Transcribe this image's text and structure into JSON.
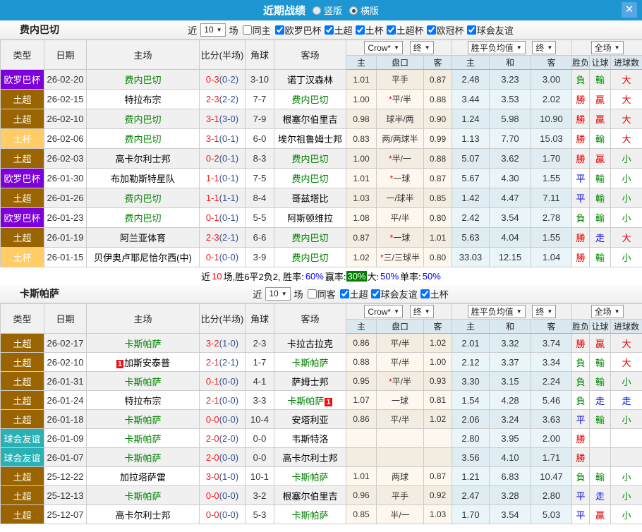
{
  "topbar": {
    "title": "近期战绩",
    "vertical_label": "竖版",
    "horizontal_label": "横版",
    "close_glyph": "✕"
  },
  "table_header": {
    "type": "类型",
    "date": "日期",
    "home": "主场",
    "score": "比分(半场)",
    "corner": "角球",
    "away": "客场",
    "sub": [
      "主",
      "盘口",
      "客",
      "主",
      "和",
      "客",
      "胜负",
      "让球",
      "进球数"
    ],
    "selects": {
      "company": "Crow*",
      "final": "终",
      "avg": "胜平负均值",
      "scope": "全场"
    },
    "arrow": "▼"
  },
  "colors": {
    "europa": "#7d00da",
    "super_lig": "#9a6500",
    "cup": "#ffcc66",
    "friendly": "#29b1b6",
    "team_green": "#008000",
    "win": "#e60000",
    "lose": "#008800",
    "draw": "#0000e0"
  },
  "sections": [
    {
      "team": "费内巴切",
      "filter": {
        "near_label": "近",
        "count": "10",
        "unit_label": "场",
        "same_label": "同主",
        "leagues": [
          "欧罗巴杯",
          "土超",
          "土杯",
          "土超杯",
          "欧冠杯",
          "球会友谊"
        ]
      },
      "rows": [
        {
          "type": "欧罗巴杯",
          "type_color": "#7d00da",
          "date": "26-02-20",
          "home": "费内巴切",
          "home_color": "#008000",
          "score": "0-3",
          "half": "(0-2)",
          "corner": "3-10",
          "away": "诺丁汉森林",
          "w1": "1.01",
          "handicap": "平手",
          "w2": "0.87",
          "avg_h": "2.48",
          "avg_d": "3.23",
          "avg_a": "3.00",
          "wdl": "負",
          "wdl_color": "#008800",
          "asian": "輸",
          "asian_color": "#008800",
          "ou": "大",
          "ou_color": "#e60000"
        },
        {
          "type": "土超",
          "type_color": "#9a6500",
          "date": "26-02-15",
          "home": "特拉布宗",
          "score": "2-3",
          "half": "(2-2)",
          "corner": "7-7",
          "away": "费内巴切",
          "away_color": "#008000",
          "w1": "1.00",
          "hstar": "*",
          "handicap": "平/半",
          "w2": "0.88",
          "avg_h": "3.44",
          "avg_d": "3.53",
          "avg_a": "2.02",
          "wdl": "勝",
          "wdl_color": "#e60000",
          "asian": "贏",
          "asian_color": "#e60000",
          "ou": "大",
          "ou_color": "#e60000"
        },
        {
          "type": "土超",
          "type_color": "#9a6500",
          "date": "26-02-10",
          "home": "费内巴切",
          "home_color": "#008000",
          "score": "3-1",
          "half": "(3-0)",
          "corner": "7-9",
          "away": "根塞尔伯里吉",
          "w1": "0.98",
          "handicap": "球半/两",
          "w2": "0.90",
          "avg_h": "1.24",
          "avg_d": "5.98",
          "avg_a": "10.90",
          "wdl": "勝",
          "wdl_color": "#e60000",
          "asian": "贏",
          "asian_color": "#e60000",
          "ou": "大",
          "ou_color": "#e60000"
        },
        {
          "type": "土杯",
          "type_color": "#ffcc66",
          "date": "26-02-06",
          "home": "费内巴切",
          "home_color": "#008000",
          "score": "3-1",
          "half": "(0-1)",
          "corner": "6-0",
          "away": "埃尔祖鲁姆士邦",
          "w1": "0.83",
          "handicap": "两/两球半",
          "w2": "0.99",
          "avg_h": "1.13",
          "avg_d": "7.70",
          "avg_a": "15.03",
          "wdl": "勝",
          "wdl_color": "#e60000",
          "asian": "輸",
          "asian_color": "#008800",
          "ou": "大",
          "ou_color": "#e60000"
        },
        {
          "type": "土超",
          "type_color": "#9a6500",
          "date": "26-02-03",
          "home": "高卡尔利士邦",
          "score": "0-2",
          "half": "(0-1)",
          "corner": "8-3",
          "away": "费内巴切",
          "away_color": "#008000",
          "w1": "1.00",
          "hstar": "*",
          "handicap": "半/一",
          "w2": "0.88",
          "avg_h": "5.07",
          "avg_d": "3.62",
          "avg_a": "1.70",
          "wdl": "勝",
          "wdl_color": "#e60000",
          "asian": "贏",
          "asian_color": "#e60000",
          "ou": "小",
          "ou_color": "#008800"
        },
        {
          "type": "欧罗巴杯",
          "type_color": "#7d00da",
          "date": "26-01-30",
          "home": "布加勒斯特星队",
          "score": "1-1",
          "half": "(0-1)",
          "corner": "7-5",
          "away": "费内巴切",
          "away_color": "#008000",
          "w1": "1.01",
          "hstar": "*",
          "handicap": "一球",
          "w2": "0.87",
          "avg_h": "5.67",
          "avg_d": "4.30",
          "avg_a": "1.55",
          "wdl": "平",
          "wdl_color": "#0000e0",
          "asian": "輸",
          "asian_color": "#008800",
          "ou": "小",
          "ou_color": "#008800"
        },
        {
          "type": "土超",
          "type_color": "#9a6500",
          "date": "26-01-26",
          "home": "费内巴切",
          "home_color": "#008000",
          "score": "1-1",
          "half": "(1-1)",
          "corner": "8-4",
          "away": "哥兹塔比",
          "w1": "1.03",
          "handicap": "一/球半",
          "w2": "0.85",
          "avg_h": "1.42",
          "avg_d": "4.47",
          "avg_a": "7.11",
          "wdl": "平",
          "wdl_color": "#0000e0",
          "asian": "輸",
          "asian_color": "#008800",
          "ou": "小",
          "ou_color": "#008800"
        },
        {
          "type": "欧罗巴杯",
          "type_color": "#7d00da",
          "date": "26-01-23",
          "home": "费内巴切",
          "home_color": "#008000",
          "score": "0-1",
          "half": "(0-1)",
          "corner": "5-5",
          "away": "阿斯顿维拉",
          "w1": "1.08",
          "handicap": "平/半",
          "w2": "0.80",
          "avg_h": "2.42",
          "avg_d": "3.54",
          "avg_a": "2.78",
          "wdl": "負",
          "wdl_color": "#008800",
          "asian": "輸",
          "asian_color": "#008800",
          "ou": "小",
          "ou_color": "#008800"
        },
        {
          "type": "土超",
          "type_color": "#9a6500",
          "date": "26-01-19",
          "home": "阿兰亚体育",
          "score": "2-3",
          "half": "(2-1)",
          "corner": "6-6",
          "away": "费内巴切",
          "away_color": "#008000",
          "w1": "0.87",
          "hstar": "*",
          "handicap": "一球",
          "w2": "1.01",
          "avg_h": "5.63",
          "avg_d": "4.04",
          "avg_a": "1.55",
          "wdl": "勝",
          "wdl_color": "#e60000",
          "asian": "走",
          "asian_color": "#0000e0",
          "ou": "大",
          "ou_color": "#e60000"
        },
        {
          "type": "土杯",
          "type_color": "#ffcc66",
          "date": "26-01-15",
          "home": "贝伊奥卢耶尼恰尔西(中)",
          "score": "0-1",
          "half": "(0-0)",
          "corner": "3-9",
          "away": "费内巴切",
          "away_color": "#008000",
          "w1": "1.02",
          "hstar": "*",
          "handicap": "三/三球半",
          "w2": "0.80",
          "avg_h": "33.03",
          "avg_d": "12.15",
          "avg_a": "1.04",
          "wdl": "勝",
          "wdl_color": "#e60000",
          "asian": "輸",
          "asian_color": "#008800",
          "ou": "小",
          "ou_color": "#008800"
        }
      ],
      "summary": [
        {
          "text": "近",
          "color": "#000000"
        },
        {
          "text": "10",
          "color": "#ff0000"
        },
        {
          "text": "场,胜6平2负2, 胜率:",
          "color": "#000000"
        },
        {
          "text": "60%",
          "color": "#0000ff"
        },
        {
          "text": " 赢率: ",
          "color": "#000000"
        },
        {
          "text": "30%",
          "color": "#ffffff",
          "bg": "#008000"
        },
        {
          "text": " 大:",
          "color": "#000000"
        },
        {
          "text": "50%",
          "color": "#0000ff"
        },
        {
          "text": " 单率:",
          "color": "#000000"
        },
        {
          "text": "50%",
          "color": "#0000ff"
        }
      ]
    },
    {
      "team": "卡斯帕萨",
      "filter": {
        "near_label": "近",
        "count": "10",
        "unit_label": "场",
        "same_label": "同客",
        "leagues": [
          "土超",
          "球会友谊",
          "土杯"
        ]
      },
      "rows": [
        {
          "type": "土超",
          "type_color": "#9a6500",
          "date": "26-02-17",
          "home": "卡斯帕萨",
          "home_color": "#008000",
          "score": "3-2",
          "half": "(1-0)",
          "corner": "2-3",
          "away": "卡拉古拉克",
          "w1": "0.86",
          "handicap": "平/半",
          "w2": "1.02",
          "avg_h": "2.01",
          "avg_d": "3.32",
          "avg_a": "3.74",
          "wdl": "勝",
          "wdl_color": "#e60000",
          "asian": "贏",
          "asian_color": "#e60000",
          "ou": "大",
          "ou_color": "#e60000"
        },
        {
          "type": "土超",
          "type_color": "#9a6500",
          "date": "26-02-10",
          "home_card_pre": "1",
          "home": "加斯安泰普",
          "score": "2-1",
          "half": "(2-1)",
          "corner": "1-7",
          "away": "卡斯帕萨",
          "away_color": "#008000",
          "w1": "0.88",
          "handicap": "平/半",
          "w2": "1.00",
          "avg_h": "2.12",
          "avg_d": "3.37",
          "avg_a": "3.34",
          "wdl": "負",
          "wdl_color": "#008800",
          "asian": "輸",
          "asian_color": "#008800",
          "ou": "大",
          "ou_color": "#e60000"
        },
        {
          "type": "土超",
          "type_color": "#9a6500",
          "date": "26-01-31",
          "home": "卡斯帕萨",
          "home_color": "#008000",
          "score": "0-1",
          "half": "(0-0)",
          "corner": "4-1",
          "away": "萨姆士邦",
          "w1": "0.95",
          "hstar": "*",
          "handicap": "平/半",
          "w2": "0.93",
          "avg_h": "3.30",
          "avg_d": "3.15",
          "avg_a": "2.24",
          "wdl": "負",
          "wdl_color": "#008800",
          "asian": "輸",
          "asian_color": "#008800",
          "ou": "小",
          "ou_color": "#008800"
        },
        {
          "type": "土超",
          "type_color": "#9a6500",
          "date": "26-01-24",
          "home": "特拉布宗",
          "score": "2-1",
          "half": "(0-0)",
          "corner": "3-3",
          "away": "卡斯帕萨",
          "away_color": "#008000",
          "away_card_post": "1",
          "w1": "1.07",
          "handicap": "一球",
          "w2": "0.81",
          "avg_h": "1.54",
          "avg_d": "4.28",
          "avg_a": "5.46",
          "wdl": "負",
          "wdl_color": "#008800",
          "asian": "走",
          "asian_color": "#0000e0",
          "ou": "走",
          "ou_color": "#0000e0"
        },
        {
          "type": "土超",
          "type_color": "#9a6500",
          "date": "26-01-18",
          "home": "卡斯帕萨",
          "home_color": "#008000",
          "score": "0-0",
          "half": "(0-0)",
          "corner": "10-4",
          "away": "安塔利亚",
          "w1": "0.86",
          "handicap": "平/半",
          "w2": "1.02",
          "avg_h": "2.06",
          "avg_d": "3.24",
          "avg_a": "3.63",
          "wdl": "平",
          "wdl_color": "#0000e0",
          "asian": "輸",
          "asian_color": "#008800",
          "ou": "小",
          "ou_color": "#008800"
        },
        {
          "type": "球会友谊",
          "type_color": "#29b1b6",
          "date": "26-01-09",
          "home": "卡斯帕萨",
          "home_color": "#008000",
          "score": "2-0",
          "half": "(2-0)",
          "corner": "0-0",
          "away": "韦斯特洛",
          "avg_h": "2.80",
          "avg_d": "3.95",
          "avg_a": "2.00",
          "wdl": "勝",
          "wdl_color": "#e60000"
        },
        {
          "type": "球会友谊",
          "type_color": "#29b1b6",
          "date": "26-01-07",
          "home": "卡斯帕萨",
          "home_color": "#008000",
          "score": "2-0",
          "half": "(0-0)",
          "corner": "0-0",
          "away": "高卡尔利士邦",
          "avg_h": "3.56",
          "avg_d": "4.10",
          "avg_a": "1.71",
          "wdl": "勝",
          "wdl_color": "#e60000"
        },
        {
          "type": "土超",
          "type_color": "#9a6500",
          "date": "25-12-22",
          "home": "加拉塔萨雷",
          "score": "3-0",
          "half": "(1-0)",
          "corner": "10-1",
          "away": "卡斯帕萨",
          "away_color": "#008000",
          "w1": "1.01",
          "handicap": "两球",
          "w2": "0.87",
          "avg_h": "1.21",
          "avg_d": "6.83",
          "avg_a": "10.47",
          "wdl": "負",
          "wdl_color": "#008800",
          "asian": "輸",
          "asian_color": "#008800",
          "ou": "小",
          "ou_color": "#008800"
        },
        {
          "type": "土超",
          "type_color": "#9a6500",
          "date": "25-12-13",
          "home": "卡斯帕萨",
          "home_color": "#008000",
          "score": "0-0",
          "half": "(0-0)",
          "corner": "3-2",
          "away": "根塞尔伯里吉",
          "w1": "0.96",
          "handicap": "平手",
          "w2": "0.92",
          "avg_h": "2.47",
          "avg_d": "3.28",
          "avg_a": "2.80",
          "wdl": "平",
          "wdl_color": "#0000e0",
          "asian": "走",
          "asian_color": "#0000e0",
          "ou": "小",
          "ou_color": "#008800"
        },
        {
          "type": "土超",
          "type_color": "#9a6500",
          "date": "25-12-07",
          "home": "高卡尔利士邦",
          "score": "0-0",
          "half": "(0-0)",
          "corner": "5-3",
          "away": "卡斯帕萨",
          "away_color": "#008000",
          "w1": "0.85",
          "handicap": "半/一",
          "w2": "1.03",
          "avg_h": "1.70",
          "avg_d": "3.54",
          "avg_a": "5.03",
          "wdl": "平",
          "wdl_color": "#0000e0",
          "asian": "贏",
          "asian_color": "#e60000",
          "ou": "小",
          "ou_color": "#008800"
        }
      ]
    }
  ]
}
